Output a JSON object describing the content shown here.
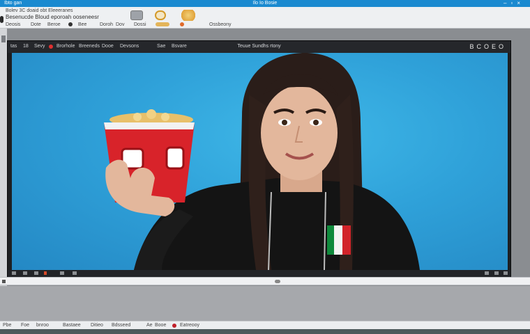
{
  "title_bar": {
    "left_text": "Ibto gan",
    "center_text": "Ilo Io Bosie"
  },
  "ribbon": {
    "line1": "Bolev 3C doaid obt Eleeeranes",
    "line2": "Besenucde Bloud eporoah ooseneesr",
    "line3_items": [
      "Deosis",
      "Dote",
      "Beroe",
      "Bee",
      "Doroh",
      "Dov",
      "Dossi",
      "Ossbeony"
    ]
  },
  "app": {
    "menu_items": [
      "tas",
      "18",
      "Sevy",
      "Brorhole",
      "Breeneds",
      "Dooe",
      "Devsons",
      "Sae",
      "Bsvare"
    ],
    "title": "Teuue Sundhs rtony",
    "right_icons": [
      "B",
      "C",
      "O",
      "E",
      "O"
    ]
  },
  "taskbar": {
    "items": [
      "Pbe",
      "Foe",
      "bnroo",
      "Bastaee",
      "Ditieo",
      "Bdsseed",
      "Ae",
      "Booe",
      "Eatreooy"
    ]
  },
  "colors": {
    "title_blue": "#1a8ad0",
    "backdrop_blue": "#2fa1d9",
    "popcorn_red": "#d8232a",
    "app_dark": "#1d1f22"
  }
}
